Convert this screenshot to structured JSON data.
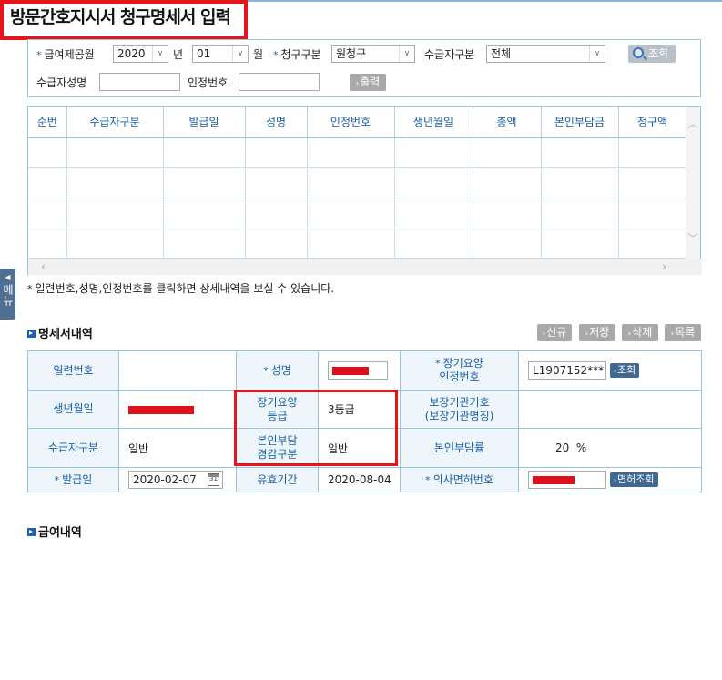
{
  "title": "방문간호지시서 청구명세서 입력",
  "search": {
    "year_month_label": "급여제공월",
    "year_value": "2020",
    "year_unit": "년",
    "month_value": "01",
    "month_unit": "월",
    "claim_type_label": "청구구분",
    "claim_type_value": "원청구",
    "recipient_type_label": "수급자구분",
    "recipient_type_value": "전체",
    "search_button": "조회",
    "recipient_name_label": "수급자성명",
    "recipient_name_value": "",
    "cert_no_label": "인정번호",
    "cert_no_value": "",
    "print_button": "출력"
  },
  "grid": {
    "columns": [
      "순번",
      "수급자구분",
      "발급일",
      "성명",
      "인정번호",
      "생년월일",
      "총액",
      "본인부담금",
      "청구액"
    ],
    "rows": [
      [
        "",
        "",
        "",
        "",
        "",
        "",
        "",
        "",
        ""
      ],
      [
        "",
        "",
        "",
        "",
        "",
        "",
        "",
        "",
        ""
      ],
      [
        "",
        "",
        "",
        "",
        "",
        "",
        "",
        "",
        ""
      ],
      [
        "",
        "",
        "",
        "",
        "",
        "",
        "",
        "",
        ""
      ]
    ]
  },
  "note": "일련번호,성명,인정번호를 클릭하면 상세내역을 보실 수 있습니다.",
  "side_menu": "메뉴",
  "detail": {
    "section_title": "명세서내역",
    "buttons": {
      "new": "신규",
      "save": "저장",
      "delete": "삭제",
      "list": "목록"
    },
    "serial_label": "일련번호",
    "serial_value": "",
    "name_label": "성명",
    "ltc_cert_label_1": "장기요양",
    "ltc_cert_label_2": "인정번호",
    "ltc_cert_value": "L1907152***",
    "ltc_cert_button": "조회",
    "birth_label": "생년월일",
    "grade_label_1": "장기요양",
    "grade_label_2": "등급",
    "grade_value": "3등급",
    "institution_label_1": "보장기관기호",
    "institution_label_2": "(보장기관명칭)",
    "institution_value": "",
    "recipient_type_label": "수급자구분",
    "recipient_type_value": "일반",
    "reduction_label_1": "본인부담",
    "reduction_label_2": "경감구분",
    "reduction_value": "일반",
    "copay_rate_label": "본인부담률",
    "copay_rate_value": "20",
    "copay_rate_unit": "%",
    "issue_date_label": "발급일",
    "issue_date_value": "2020-02-07",
    "validity_label": "유효기간",
    "validity_value": "2020-08-04",
    "doctor_license_label": "의사면허번호",
    "doctor_license_button": "면허조회"
  },
  "benefit_section_title": "급여내역",
  "colors": {
    "accent_blue": "#1a5fa8",
    "border_blue": "#9cc3dd",
    "highlight_red": "#e8141c",
    "gray_button": "#a9a9a9",
    "dark_button": "#3f6894"
  }
}
